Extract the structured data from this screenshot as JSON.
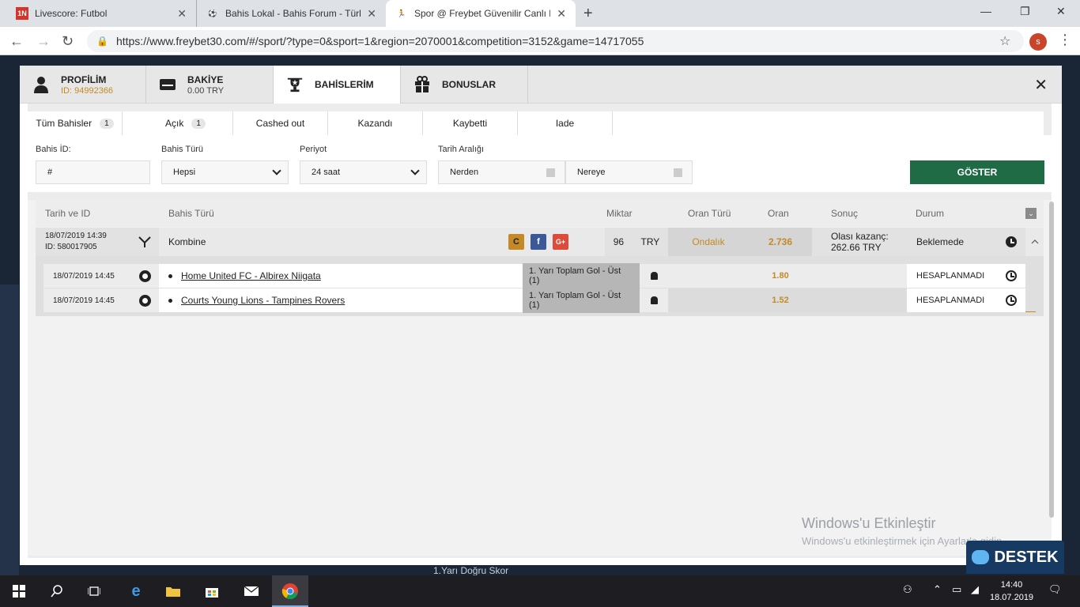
{
  "browser": {
    "tabs": [
      {
        "favicon": "1N",
        "title": "Livescore: Futbol"
      },
      {
        "favicon": "⚽",
        "title": "Bahis Lokal - Bahis Forum - Türk"
      },
      {
        "favicon": "🏃",
        "title": "Spor @ Freybet Güvenilir Canlı B"
      }
    ],
    "url": "https://www.freybet30.com/#/sport/?type=0&sport=1&region=2070001&competition=3152&game=14717055",
    "profile_initial": "s"
  },
  "modal": {
    "tabs": {
      "profile": {
        "label": "PROFİLİM",
        "sub": "ID: 94992366"
      },
      "balance": {
        "label": "BAKİYE",
        "sub": "0.00 TRY"
      },
      "bets": {
        "label": "BAHİSLERİM"
      },
      "bonus": {
        "label": "BONUSLAR"
      }
    },
    "filter_tabs": [
      {
        "label": "Tüm Bahisler",
        "count": "1"
      },
      {
        "label": "Açık",
        "count": "1"
      },
      {
        "label": "Cashed out"
      },
      {
        "label": "Kazandı"
      },
      {
        "label": "Kaybetti"
      },
      {
        "label": "Iade"
      }
    ],
    "filters": {
      "bet_id_label": "Bahis İD:",
      "bet_id_value": "#",
      "bet_type_label": "Bahis Türü",
      "bet_type_value": "Hepsi",
      "period_label": "Periyot",
      "period_value": "24 saat",
      "date_range_label": "Tarih Aralığı",
      "from_value": "Nerden",
      "to_value": "Nereye",
      "show_button": "GÖSTER"
    },
    "table": {
      "headers": {
        "date": "Tarih ve ID",
        "type": "Bahis Türü",
        "amount": "Miktar",
        "odd_type": "Oran Türü",
        "odd": "Oran",
        "result": "Sonuç",
        "status": "Durum"
      },
      "bet": {
        "date": "18/07/2019 14:39",
        "id": "ID: 580017905",
        "type": "Kombine",
        "amount": "96",
        "currency": "TRY",
        "odd_type": "Ondalık",
        "odd": "2.736",
        "result_label": "Olası kazanç:",
        "result_value": "262.66 TRY",
        "status": "Beklemede"
      },
      "selections": [
        {
          "date": "18/07/2019 14:45",
          "event": "Home United FC - Albirex Niigata",
          "market": "1. Yarı Toplam Gol - Üst (1)",
          "odd": "1.80",
          "status": "HESAPLANMADI"
        },
        {
          "date": "18/07/2019 14:45",
          "event": "Courts Young Lions - Tampines Rovers",
          "market": "1. Yarı Toplam Gol - Üst (1)",
          "odd": "1.52",
          "status": "HESAPLANMADI"
        }
      ]
    }
  },
  "background": {
    "bottom_text": "1.Yarı Doğru Skor"
  },
  "watermark": {
    "line1": "Windows'u Etkinleştir",
    "line2": "Windows'u etkinleştirmek için Ayarlar'a gidin."
  },
  "destek": "DESTEK",
  "taskbar": {
    "time": "14:40",
    "date": "18.07.2019"
  },
  "colors": {
    "accent_gold": "#c38a25",
    "show_button": "#1f6b45",
    "destek_bg": "#173a63"
  }
}
